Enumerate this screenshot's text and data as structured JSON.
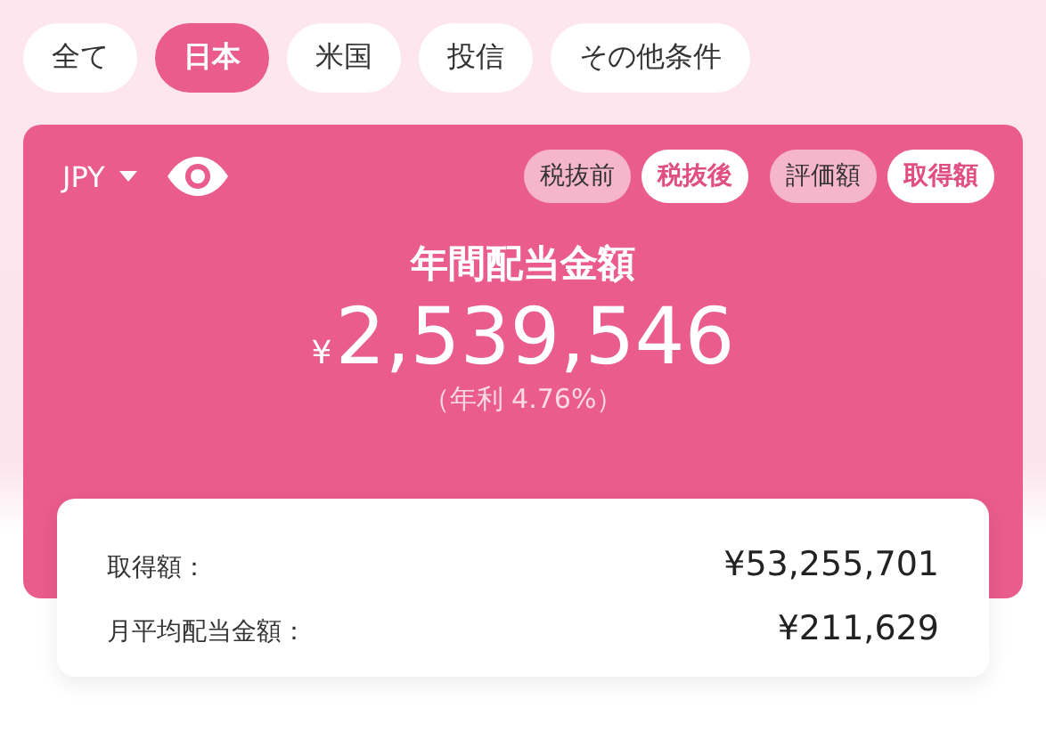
{
  "filter_tabs": [
    {
      "label": "全て",
      "selected": false
    },
    {
      "label": "日本",
      "selected": true
    },
    {
      "label": "米国",
      "selected": false
    },
    {
      "label": "投信",
      "selected": false
    },
    {
      "label": "その他条件",
      "selected": false
    }
  ],
  "summary": {
    "currency": "JPY",
    "tax_toggle": [
      {
        "label": "税抜前",
        "selected": false
      },
      {
        "label": "税抜後",
        "selected": true
      }
    ],
    "basis_toggle": [
      {
        "label": "評価額",
        "selected": false
      },
      {
        "label": "取得額",
        "selected": true
      }
    ],
    "title": "年間配当金額",
    "currency_symbol": "¥",
    "amount": "2,539,546",
    "yield": "（年利 4.76%）"
  },
  "details": [
    {
      "label": "取得額：",
      "value": "¥53,255,701"
    },
    {
      "label": "月平均配当金額：",
      "value": "¥211,629"
    }
  ]
}
